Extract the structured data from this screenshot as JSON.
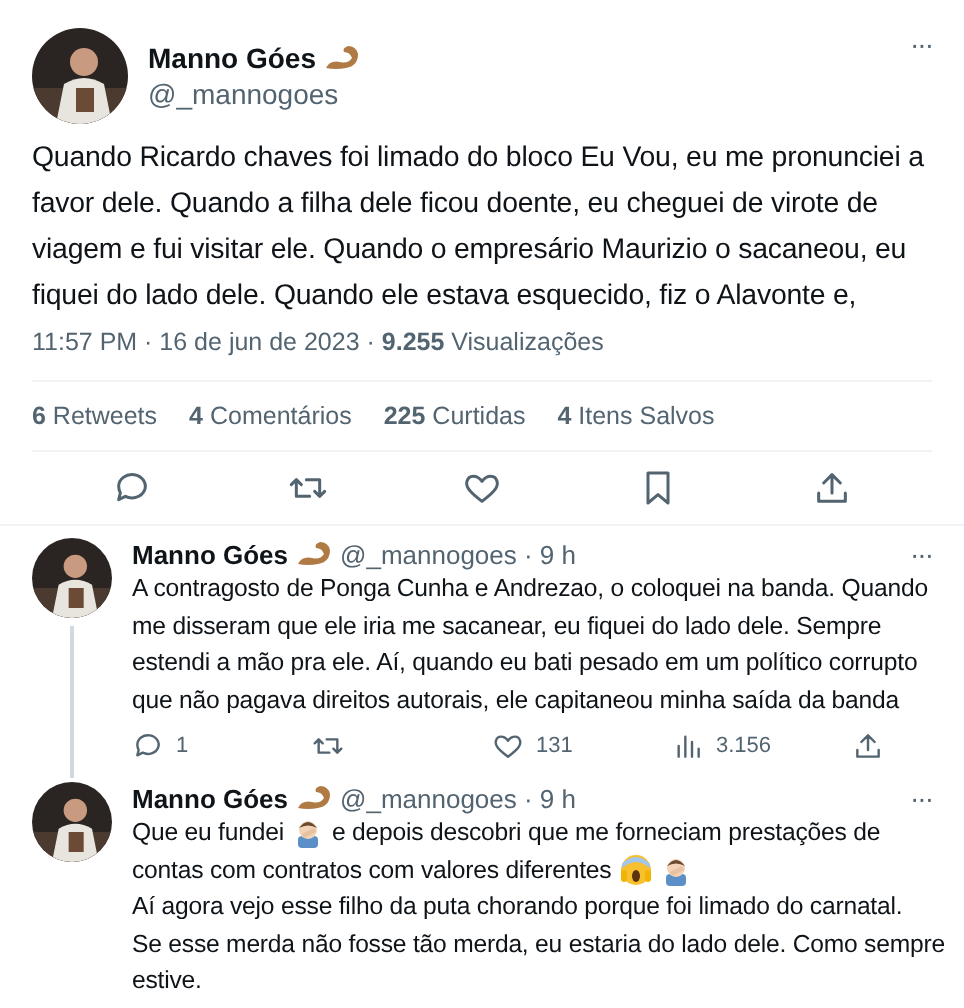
{
  "tweet": {
    "name": "Manno Góes",
    "handle": "@_mannogoes",
    "more": "···",
    "lines": [
      "Quando Ricardo chaves foi limado do bloco Eu Vou, eu me pronunciei a",
      "favor dele. Quando a filha dele ficou doente, eu cheguei de virote de",
      "viagem e fui visitar ele. Quando o empresário Maurizio o sacaneou, eu",
      "fiquei do lado dele. Quando ele estava esquecido, fiz o Alavonte e,"
    ],
    "meta": "11:57 PM · 16 de jun de 2023 · **9.255** Visualizações",
    "stats": [
      "**6** Retweets",
      "**4** Comentários",
      "**225** Curtidas",
      "**4** Itens Salvos"
    ],
    "actions": [
      {
        "kind": "reply"
      },
      {
        "kind": "retweet"
      },
      {
        "kind": "like"
      },
      {
        "kind": "bookmark"
      },
      {
        "kind": "share"
      }
    ]
  },
  "replies": [
    {
      "name": "Manno Góes",
      "handle": "@_mannogoes · 9 h",
      "more": "···",
      "thread": true,
      "lines": [
        [
          {
            "kind": "text",
            "text": "A contragosto de Ponga Cunha e Andrezao, o coloquei na banda. Quando"
          }
        ],
        [
          {
            "kind": "text",
            "text": "me disseram que ele iria me sacanear, eu fiquei do lado dele. Sempre"
          }
        ],
        [
          {
            "kind": "text",
            "text": "estendi a mão pra ele. Aí, quando eu bati pesado em um político corrupto"
          }
        ],
        [
          {
            "kind": "text",
            "text": "que não pagava direitos autorais, ele capitaneou minha saída da banda"
          }
        ]
      ],
      "actions": [
        {
          "kind": "reply",
          "count": "1"
        },
        {
          "kind": "retweet"
        },
        {
          "kind": "like",
          "count": "131"
        },
        {
          "kind": "views",
          "count": "3.156"
        },
        {
          "kind": "share"
        }
      ]
    },
    {
      "name": "Manno Góes",
      "handle": "@_mannogoes · 9 h",
      "more": "···",
      "thread": false,
      "lines": [
        [
          {
            "kind": "text",
            "text": "Que eu fundei"
          },
          {
            "kind": "facepalm"
          },
          {
            "kind": "text",
            "text": "e depois descobri que me forneciam prestações de"
          }
        ],
        [
          {
            "kind": "text",
            "text": "contas com contratos com valores diferentes"
          },
          {
            "kind": "scream"
          },
          {
            "kind": "facepalm"
          }
        ],
        [
          {
            "kind": "text",
            "text": "Aí agora vejo esse filho da puta chorando porque foi limado do carnatal."
          }
        ],
        [
          {
            "kind": "text",
            "text": "Se esse merda não fosse tão merda, eu estaria do lado dele. Como sempre"
          }
        ],
        [
          {
            "kind": "text",
            "text": "estive."
          }
        ]
      ]
    }
  ]
}
